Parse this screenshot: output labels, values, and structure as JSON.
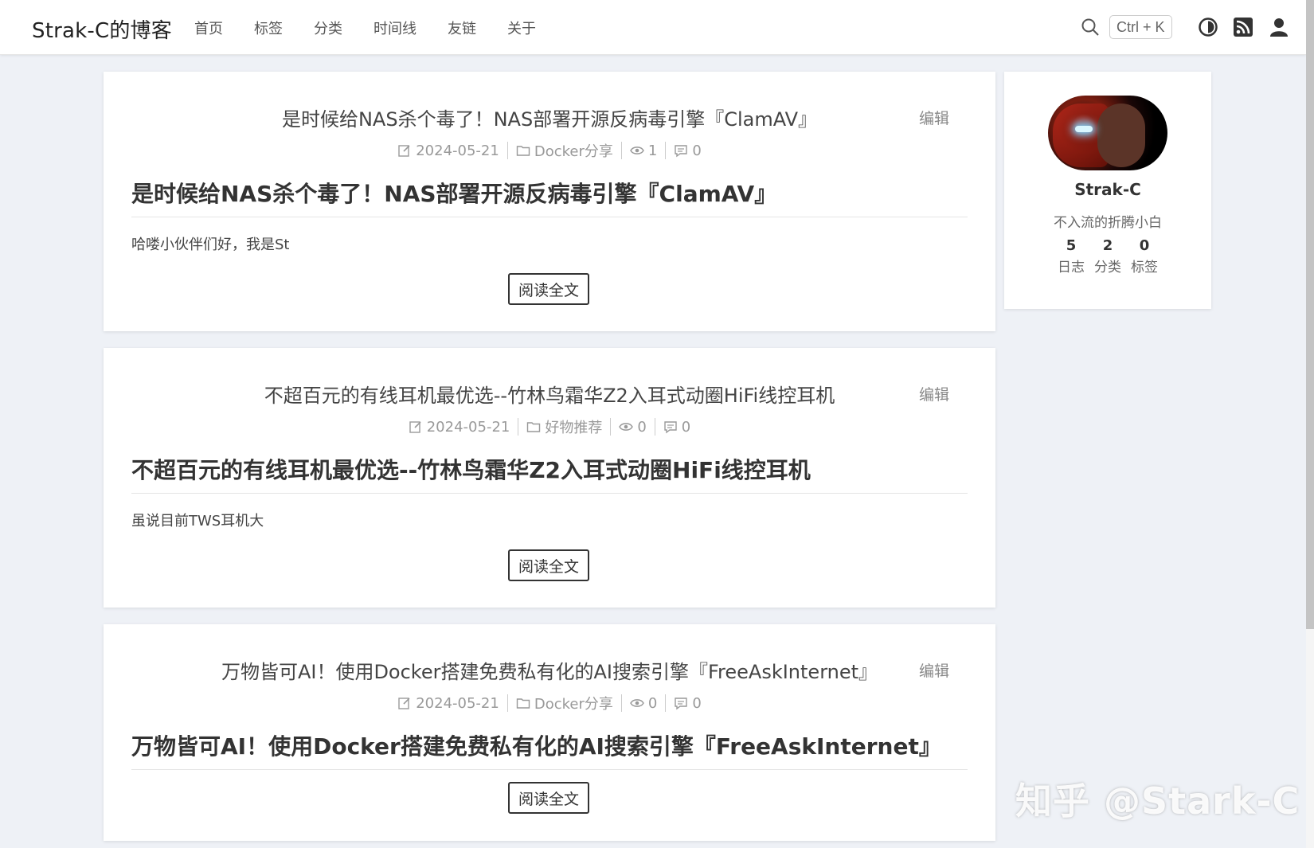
{
  "site": {
    "brand": "Strak-C的博客",
    "nav": [
      "首页",
      "标签",
      "分类",
      "时间线",
      "友链",
      "关于"
    ],
    "search_shortcut": "Ctrl + K",
    "icons": [
      "search-icon",
      "theme-toggle-icon",
      "rss-icon",
      "user-icon"
    ]
  },
  "posts": [
    {
      "title": "是时候给NAS杀个毒了！NAS部署开源反病毒引擎『ClamAV』",
      "edit": "编辑",
      "date": "2024-05-21",
      "category": "Docker分享",
      "views": "1",
      "comments": "0",
      "heading": "是时候给NAS杀个毒了！NAS部署开源反病毒引擎『ClamAV』",
      "excerpt": "哈喽小伙伴们好，我是St",
      "read_more": "阅读全文"
    },
    {
      "title": "不超百元的有线耳机最优选--竹林鸟霜华Z2入耳式动圈HiFi线控耳机",
      "edit": "编辑",
      "date": "2024-05-21",
      "category": "好物推荐",
      "views": "0",
      "comments": "0",
      "heading": "不超百元的有线耳机最优选--竹林鸟霜华Z2入耳式动圈HiFi线控耳机",
      "excerpt": "虽说目前TWS耳机大",
      "read_more": "阅读全文"
    },
    {
      "title": "万物皆可AI！使用Docker搭建免费私有化的AI搜索引擎『FreeAskInternet』",
      "edit": "编辑",
      "date": "2024-05-21",
      "category": "Docker分享",
      "views": "0",
      "comments": "0",
      "heading": "万物皆可AI！使用Docker搭建免费私有化的AI搜索引擎『FreeAskInternet』",
      "excerpt": "",
      "read_more": "阅读全文"
    }
  ],
  "profile": {
    "name": "Strak-C",
    "subtitle": "不入流的折腾小白",
    "stats": [
      {
        "value": "5",
        "label": "日志"
      },
      {
        "value": "2",
        "label": "分类"
      },
      {
        "value": "0",
        "label": "标签"
      }
    ]
  },
  "watermark": "知乎 @Stark-C"
}
